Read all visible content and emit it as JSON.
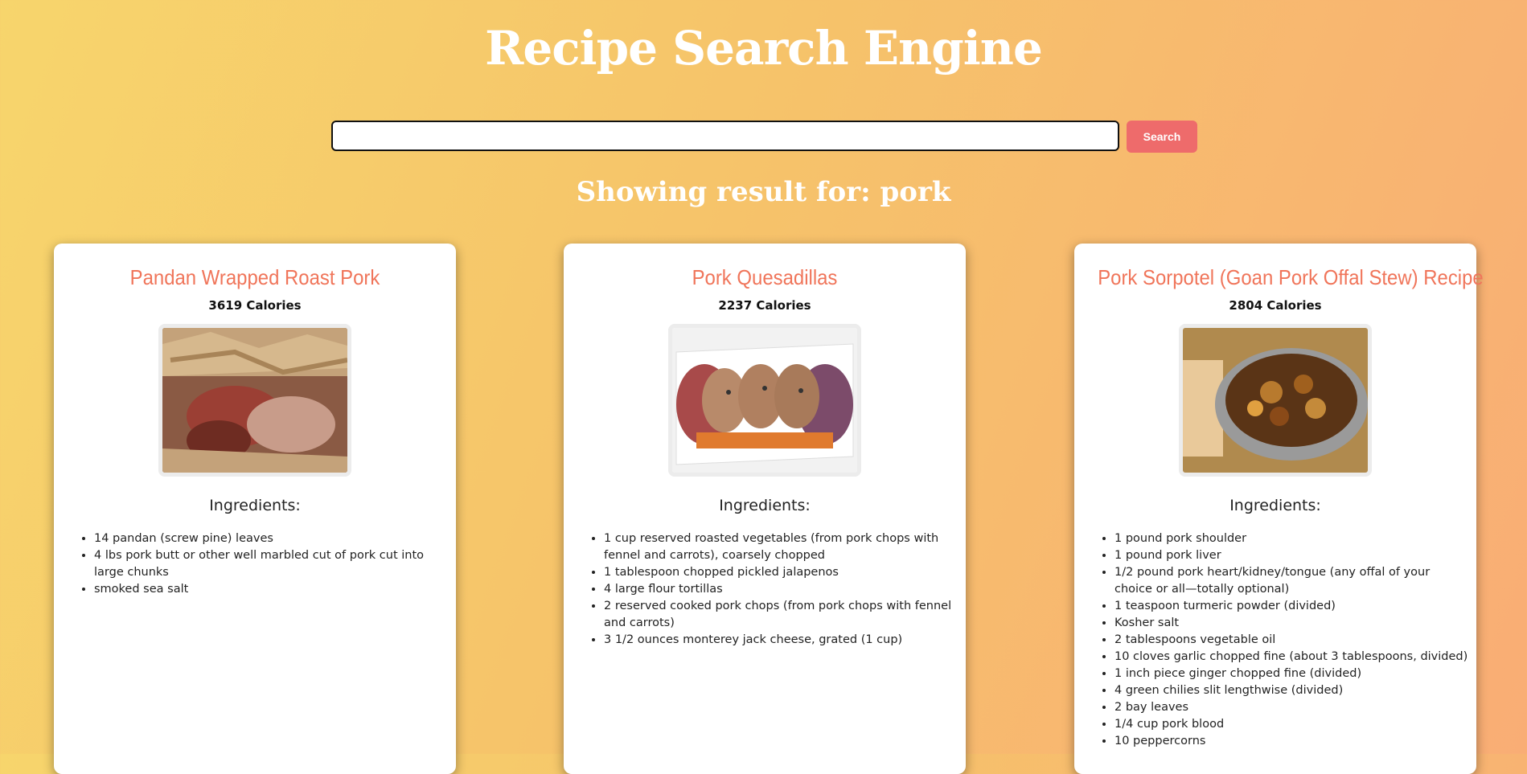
{
  "header": {
    "title": "Recipe Search Engine"
  },
  "search": {
    "value": "",
    "placeholder": "",
    "button_label": "Search"
  },
  "results_heading": "Showing result for: pork",
  "cards": [
    {
      "title": "Pandan Wrapped Roast Pork",
      "calories": "3619 Calories",
      "ingredients_heading": "Ingredients:",
      "ingredients": [
        "14 pandan (screw pine) leaves",
        "4 lbs pork butt or other well marbled cut of pork cut into large chunks",
        "smoked sea salt"
      ]
    },
    {
      "title": "Pork Quesadillas",
      "calories": "2237 Calories",
      "ingredients_heading": "Ingredients:",
      "ingredients": [
        "1 cup reserved roasted vegetables (from pork chops with fennel and carrots), coarsely chopped",
        "1 tablespoon chopped pickled jalapenos",
        "4 large flour tortillas",
        "2 reserved cooked pork chops (from pork chops with fennel and carrots)",
        "3 1/2 ounces monterey jack cheese, grated (1 cup)"
      ]
    },
    {
      "title": "Pork Sorpotel (Goan Pork Offal Stew) Recipe",
      "calories": "2804 Calories",
      "ingredients_heading": "Ingredients:",
      "ingredients": [
        "1 pound pork shoulder",
        "1 pound pork liver",
        "1/2 pound pork heart/kidney/tongue (any offal of your choice or all—totally optional)",
        "1 teaspoon turmeric powder (divided)",
        "Kosher salt",
        "2 tablespoons vegetable oil",
        "10 cloves garlic chopped fine (about 3 tablespoons, divided)",
        "1 inch piece ginger chopped fine (divided)",
        "4 green chilies slit lengthwise (divided)",
        "2 bay leaves",
        "1/4 cup pork blood",
        "10 peppercorns"
      ]
    }
  ]
}
